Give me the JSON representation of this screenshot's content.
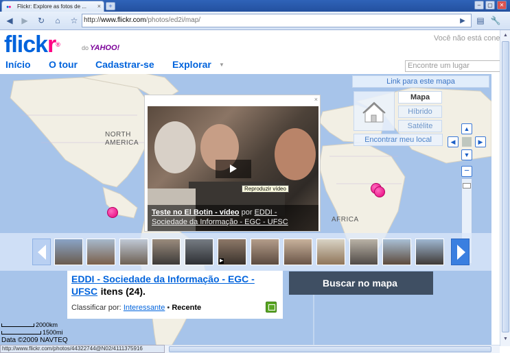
{
  "browser": {
    "tab_title": "Flickr: Explore as fotos de ...",
    "tab_close": "×",
    "new_tab": "+",
    "url_prefix": "http://",
    "url_domain": "www.flickr.com",
    "url_path": "/photos/ed2i/map/",
    "status_url": "http://www.flickr.com/photos/44322744@N02/4111375916"
  },
  "header": {
    "logo_blue": "flick",
    "logo_pink": "r",
    "logo_reg": "®",
    "yahoo_prefix": "do",
    "yahoo": "YAHOO!",
    "signed_out": "Você não está cone",
    "nav": [
      "Início",
      "O tour",
      "Cadastrar-se",
      "Explorar"
    ],
    "find_place_placeholder": "Encontre um lugar"
  },
  "map": {
    "labels": {
      "north_america": [
        "NORTH",
        "AMERICA"
      ],
      "africa": "AFRICA"
    },
    "link_to_map": "Link para este mapa",
    "types": [
      "Mapa",
      "Híbrido",
      "Satélite"
    ],
    "find_local": "Encontrar meu local",
    "scale_km": "2000km",
    "scale_mi": "1500mi",
    "copyright": "Data ©2009 NAVTEQ"
  },
  "popup": {
    "close": "×",
    "tooltip": "Reproduzir vídeo",
    "title": "Teste no El Botin - vídeo",
    "by": "por",
    "owner": "EDDI - Sociedade da Informação - EGC - UFSC"
  },
  "info": {
    "group_name": "EDDI - Sociedade da Informação - EGC - UFSC",
    "items_count": "itens (24).",
    "sort_label": "Classificar por:",
    "sort_interesting": "Interessante",
    "sort_separator": "•",
    "sort_recent": "Recente"
  },
  "search_map_button": "Buscar no mapa",
  "colors": {
    "flickr_blue": "#0063dc",
    "flickr_pink": "#ff0084",
    "map_water": "#a7c4ea",
    "map_land": "#f2efe4"
  }
}
